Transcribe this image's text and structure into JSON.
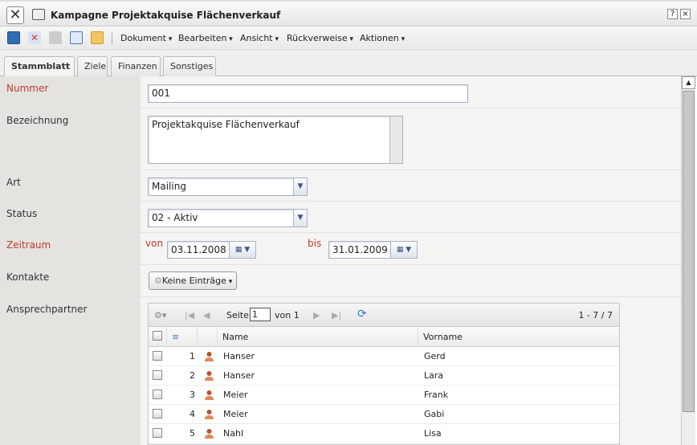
{
  "window": {
    "title": "Kampagne Projektakquise Flächenverkauf",
    "help": "?",
    "close": "×",
    "close_big": "✕"
  },
  "toolbar": {
    "menus": [
      "Dokument",
      "Bearbeiten",
      "Ansicht",
      "Rückverweise",
      "Aktionen"
    ]
  },
  "tabs": [
    "Stammblatt",
    "Ziele",
    "Finanzen",
    "Sonstiges"
  ],
  "form": {
    "nummer": {
      "label": "Nummer",
      "value": "001"
    },
    "bezeichnung": {
      "label": "Bezeichnung",
      "value": "Projektakquise Flächenverkauf"
    },
    "art": {
      "label": "Art",
      "value": "Mailing"
    },
    "status": {
      "label": "Status",
      "value": "02 - Aktiv"
    },
    "zeitraum": {
      "label": "Zeitraum",
      "von_label": "von",
      "von": "03.11.2008",
      "bis_label": "bis",
      "bis": "31.01.2009"
    },
    "kontakte": {
      "label": "Kontakte",
      "button": "Keine Einträge"
    },
    "ansprechpartner": {
      "label": "Ansprechpartner"
    }
  },
  "grid": {
    "page_label": "Seite",
    "page": "1",
    "of_label": "von 1",
    "range": "1 - 7 / 7",
    "columns": [
      "Name",
      "Vorname"
    ],
    "rows": [
      {
        "n": "1",
        "name": "Hanser",
        "vorname": "Gerd"
      },
      {
        "n": "2",
        "name": "Hanser",
        "vorname": "Lara"
      },
      {
        "n": "3",
        "name": "Meier",
        "vorname": "Frank"
      },
      {
        "n": "4",
        "name": "Meier",
        "vorname": "Gabi"
      },
      {
        "n": "5",
        "name": "Nahl",
        "vorname": "Lisa"
      }
    ]
  }
}
